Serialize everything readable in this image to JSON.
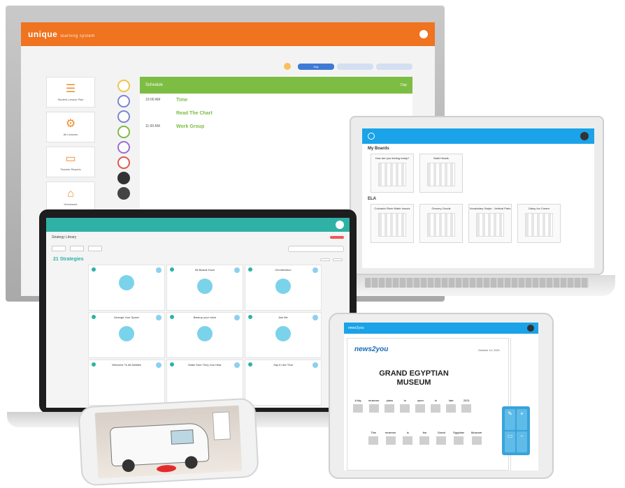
{
  "monitor": {
    "logo": "unique",
    "logo_sub": "learning system",
    "tabs": [
      "Day",
      "",
      ""
    ],
    "tiles": [
      {
        "label": "Student Lesson Plan",
        "icon": "checklist-icon"
      },
      {
        "label": "All Lessons",
        "icon": "gear-icon"
      },
      {
        "label": "Teacher Reports",
        "icon": "chart-icon"
      },
      {
        "label": "Homework",
        "icon": "home-icon"
      },
      {
        "label": "",
        "icon": "check-icon"
      }
    ],
    "schedule_header": "Schedule",
    "schedule_header_right": "Day",
    "rows": [
      {
        "time": "10:00 AM",
        "activity": "Time",
        "sub": ""
      },
      {
        "time": "",
        "activity": "Read The Chart",
        "sub": ""
      },
      {
        "time": "11:00 AM",
        "activity": "Work Group",
        "sub": ""
      }
    ]
  },
  "laptop_right": {
    "header": "",
    "section_my_boards": "My Boards",
    "boards": [
      "How are you feeling today?",
      "Math Heads"
    ],
    "section_ela": "ELA",
    "ela_boards": [
      "Colorado River Water Issues",
      "Grocery Goods",
      "Vocabulary Swipe - Vertical Pairs",
      "Daisy Ice Cream"
    ]
  },
  "laptop_center": {
    "header": "",
    "subheader": "Strategy Library",
    "new_button": "",
    "count_title": "21 Strategies",
    "cards": [
      {
        "label": ""
      },
      {
        "label": "Sit Beside Each"
      },
      {
        "label": "Get Attention"
      },
      {
        "label": "Arrange Your Space"
      },
      {
        "label": "Backup your voice"
      },
      {
        "label": "Ask Me"
      },
      {
        "label": "Welcome To All Abilities"
      },
      {
        "label": "Make Sure They Can Hear"
      },
      {
        "label": "Say it Like That"
      }
    ]
  },
  "tablet": {
    "header": "news2you",
    "logo": "news2you",
    "date": "October 14, 2021",
    "title_line1": "GRAND EGYPTIAN",
    "title_line2": "MUSEUM",
    "words_line1": [
      "A big",
      "museum",
      "plans",
      "to",
      "open",
      "in",
      "late",
      "2021"
    ],
    "words_line2": [
      "This",
      "museum",
      "is",
      "the",
      "Grand",
      "Egyptian",
      "Museum"
    ]
  }
}
